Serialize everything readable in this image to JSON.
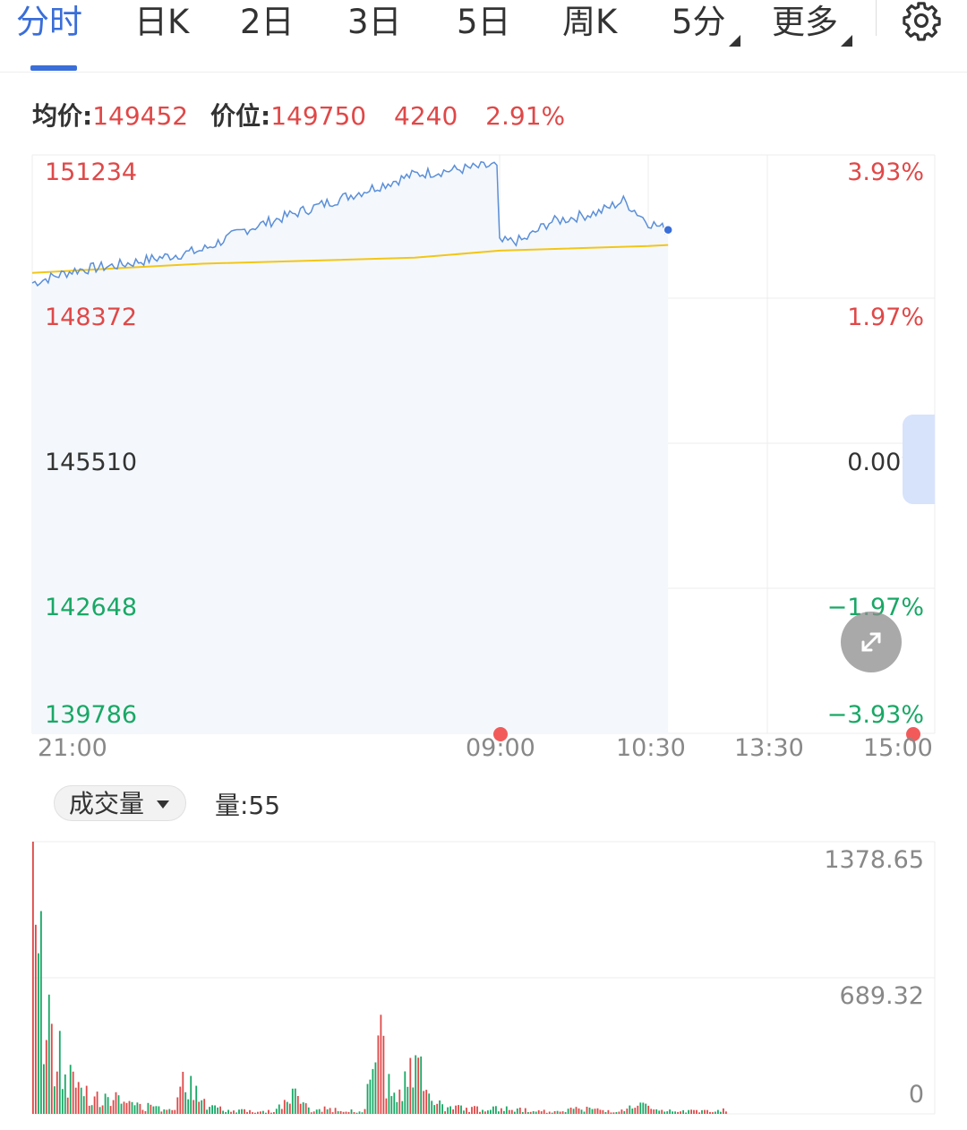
{
  "tabs": [
    {
      "label": "分时",
      "active": true
    },
    {
      "label": "日K"
    },
    {
      "label": "2日"
    },
    {
      "label": "3日"
    },
    {
      "label": "5日"
    },
    {
      "label": "周K"
    },
    {
      "label": "5分",
      "has_dropdown": true
    },
    {
      "label": "更多",
      "has_dropdown": true
    }
  ],
  "settings_icon": "gear-icon",
  "info": {
    "avg_label": "均价:",
    "avg_value": "149452",
    "price_label": "价位:",
    "price_value": "149750",
    "change": "4240",
    "change_pct": "2.91%"
  },
  "price_axis": {
    "left": [
      "151234",
      "148372",
      "145510",
      "142648",
      "139786"
    ],
    "right": [
      "3.93%",
      "1.97%",
      "0.00%",
      "−1.97%",
      "−3.93%"
    ]
  },
  "time_axis": [
    "21:00",
    "09:00",
    "10:30",
    "13:30",
    "15:00"
  ],
  "volume": {
    "dropdown_label": "成交量",
    "value_text": "量:55",
    "axis": [
      "1378.65",
      "689.32",
      "0"
    ]
  },
  "colors": {
    "accent": "#3a6ed8",
    "up": "#e04848",
    "down": "#19a866",
    "price_line": "#5b8fd8",
    "avg_line": "#f2c618"
  },
  "chart_data": [
    {
      "type": "line",
      "series": [],
      "x": [
        "21:00",
        "09:00",
        "10:30",
        "13:30",
        "15:00"
      ],
      "ylim": [
        139786,
        151234
      ],
      "price_points": [
        [
          "21:00",
          148700
        ],
        [
          "21:30",
          148950
        ],
        [
          "22:00",
          149050
        ],
        [
          "22:30",
          149200
        ],
        [
          "23:00",
          149350
        ],
        [
          "23:30",
          149750
        ],
        [
          "00:30",
          150300
        ],
        [
          "01:30",
          150850
        ],
        [
          "08:55",
          151030
        ],
        [
          "09:00",
          149500
        ],
        [
          "09:15",
          149550
        ],
        [
          "09:30",
          149900
        ],
        [
          "10:00",
          150100
        ],
        [
          "10:15",
          150330
        ],
        [
          "10:30",
          149900
        ],
        [
          "11:00",
          149750
        ]
      ],
      "avg_points": [
        [
          "21:00",
          148900
        ],
        [
          "23:00",
          149080
        ],
        [
          "01:30",
          149200
        ],
        [
          "09:00",
          149340
        ],
        [
          "10:30",
          149430
        ],
        [
          "11:00",
          149452
        ]
      ],
      "last_price": 149750,
      "average_price": 149452,
      "grid": true
    },
    {
      "type": "bar",
      "ylim": [
        0,
        1378.65
      ],
      "x": [
        "21:00",
        "09:00",
        "10:30"
      ],
      "values": [
        1378.65,
        520,
        250,
        170,
        130,
        95,
        60,
        45,
        30,
        280,
        70,
        35,
        25,
        20,
        20,
        140,
        20,
        40,
        20,
        20,
        470,
        60,
        380,
        80,
        40,
        40,
        30,
        40,
        30,
        20,
        20,
        30,
        40,
        20,
        20,
        60,
        20,
        20,
        20,
        20,
        30
      ],
      "last_volume": 55,
      "grid": true
    }
  ]
}
